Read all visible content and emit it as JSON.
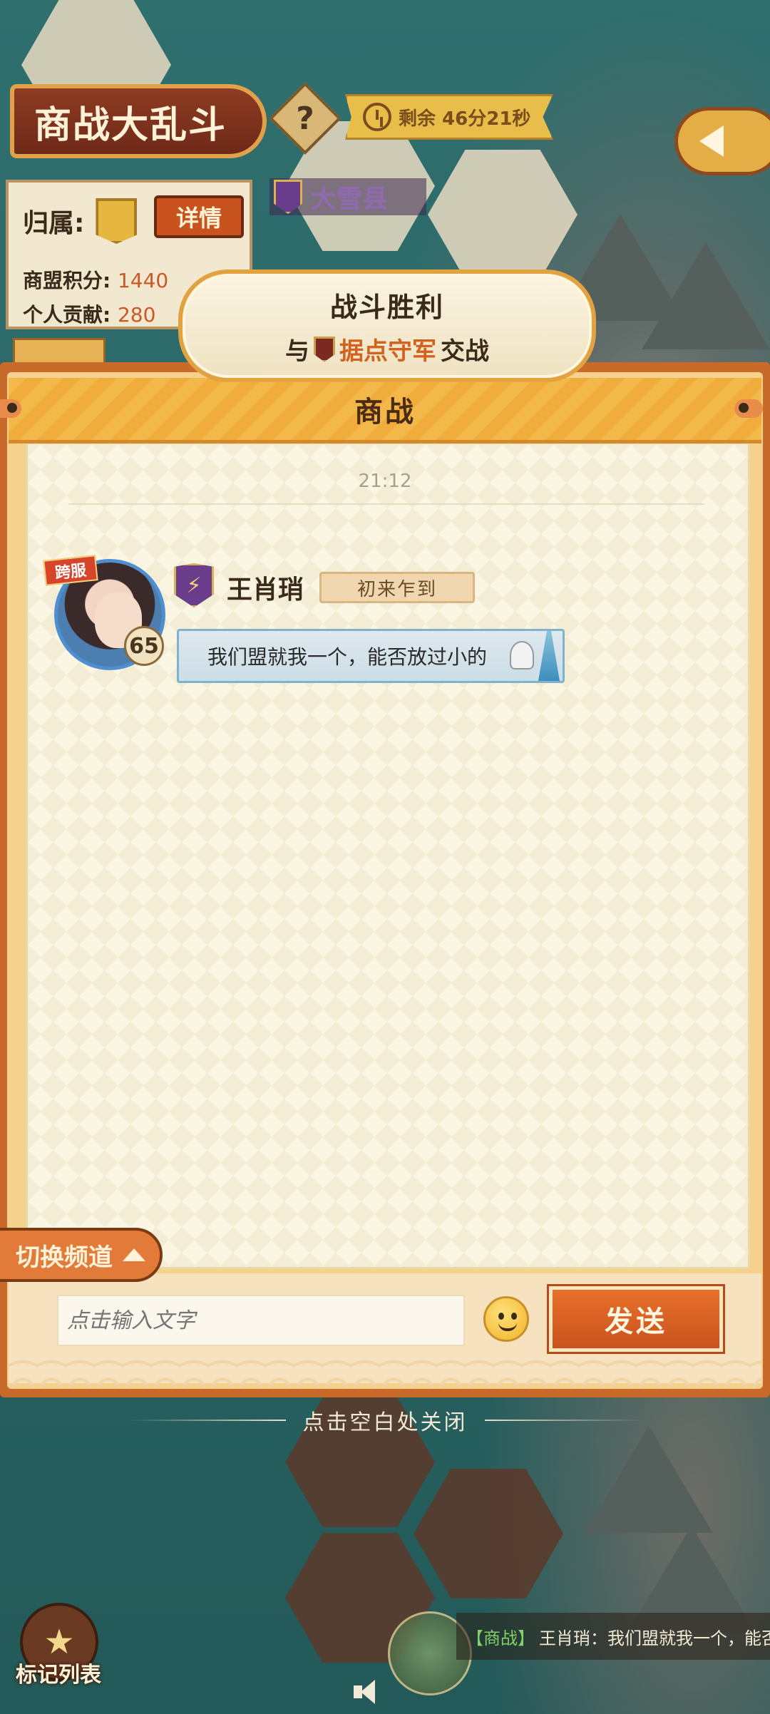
{
  "hud": {
    "event_title": "商战大乱斗",
    "help_label": "?",
    "timer_label": "剩余 46分21秒",
    "affiliation_label": "归属:",
    "detail_button": "详情",
    "alliance_score_label": "商盟积分:",
    "alliance_score_value": "1440",
    "personal_contrib_label": "个人贡献:",
    "personal_contrib_value": "280",
    "county_name": "大雪县"
  },
  "battle_result": {
    "title": "战斗胜利",
    "prefix": "与",
    "enemy": "据点守军",
    "suffix": "交战"
  },
  "chat": {
    "channel_title": "商战",
    "timestamp": "21:12",
    "messages": [
      {
        "server_badge": "跨服",
        "level": "65",
        "player_name": "王肖琑",
        "player_title": "初来乍到",
        "text": "我们盟就我一个，能否放过小的"
      }
    ],
    "switch_channel_label": "切换频道",
    "input_placeholder": "点击输入文字",
    "send_label": "发送",
    "close_hint": "点击空白处关闭"
  },
  "bottom": {
    "mark_list_label": "标记列表",
    "ticker_channel": "【商战】",
    "ticker_text": "王肖琑：我们盟就我一个，能否放过小"
  },
  "colors": {
    "accent_orange": "#e27a3a",
    "panel_paper": "#fbf6e4",
    "header_gold": "#f3b84a",
    "enemy_text": "#d2631f"
  }
}
